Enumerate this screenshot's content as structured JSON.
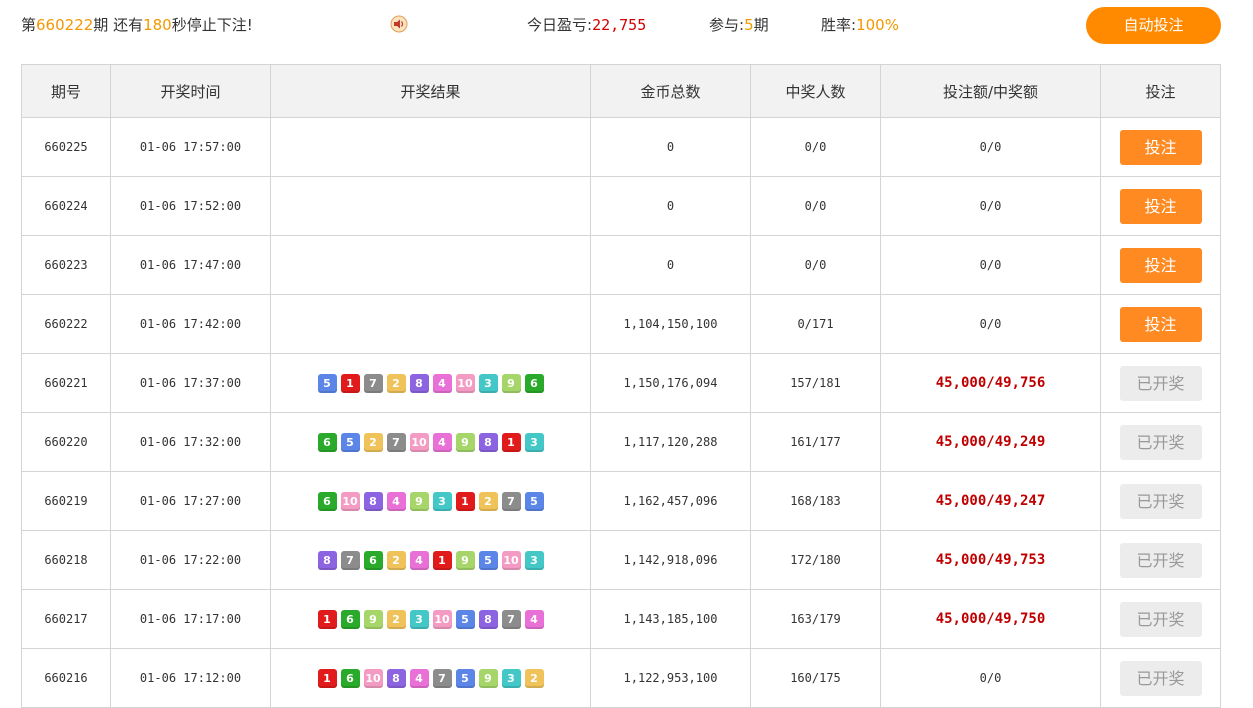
{
  "header": {
    "period_prefix": "第",
    "period_number": "660222",
    "period_suffix": "期",
    "countdown_prefix": "还有",
    "countdown_seconds": "180",
    "countdown_suffix": "秒停止下注!",
    "today_profit_label": "今日盈亏:",
    "today_profit_value": "22,755",
    "participate_label": "参与:",
    "participate_count": "5",
    "participate_suffix": "期",
    "winrate_label": "胜率:",
    "winrate_value": "100%",
    "auto_bet_label": "自动投注",
    "speaker_icon": "speaker-icon"
  },
  "table": {
    "headers": [
      "期号",
      "开奖时间",
      "开奖结果",
      "金币总数",
      "中奖人数",
      "投注额/中奖额",
      "投注"
    ],
    "rows": [
      {
        "period": "660225",
        "time": "01-06 17:57:00",
        "results": [],
        "coins": "0",
        "winners": "0/0",
        "bet": "0/0",
        "action": "投注",
        "drawn": false
      },
      {
        "period": "660224",
        "time": "01-06 17:52:00",
        "results": [],
        "coins": "0",
        "winners": "0/0",
        "bet": "0/0",
        "action": "投注",
        "drawn": false
      },
      {
        "period": "660223",
        "time": "01-06 17:47:00",
        "results": [],
        "coins": "0",
        "winners": "0/0",
        "bet": "0/0",
        "action": "投注",
        "drawn": false
      },
      {
        "period": "660222",
        "time": "01-06 17:42:00",
        "results": [],
        "coins": "1,104,150,100",
        "winners": "0/171",
        "bet": "0/0",
        "action": "投注",
        "drawn": false
      },
      {
        "period": "660221",
        "time": "01-06 17:37:00",
        "results": [
          5,
          1,
          7,
          2,
          8,
          4,
          10,
          3,
          9,
          6
        ],
        "coins": "1,150,176,094",
        "winners": "157/181",
        "bet": "45,000/49,756",
        "action": "已开奖",
        "drawn": true
      },
      {
        "period": "660220",
        "time": "01-06 17:32:00",
        "results": [
          6,
          5,
          2,
          7,
          10,
          4,
          9,
          8,
          1,
          3
        ],
        "coins": "1,117,120,288",
        "winners": "161/177",
        "bet": "45,000/49,249",
        "action": "已开奖",
        "drawn": true
      },
      {
        "period": "660219",
        "time": "01-06 17:27:00",
        "results": [
          6,
          10,
          8,
          4,
          9,
          3,
          1,
          2,
          7,
          5
        ],
        "coins": "1,162,457,096",
        "winners": "168/183",
        "bet": "45,000/49,247",
        "action": "已开奖",
        "drawn": true
      },
      {
        "period": "660218",
        "time": "01-06 17:22:00",
        "results": [
          8,
          7,
          6,
          2,
          4,
          1,
          9,
          5,
          10,
          3
        ],
        "coins": "1,142,918,096",
        "winners": "172/180",
        "bet": "45,000/49,753",
        "action": "已开奖",
        "drawn": true
      },
      {
        "period": "660217",
        "time": "01-06 17:17:00",
        "results": [
          1,
          6,
          9,
          2,
          3,
          10,
          5,
          8,
          7,
          4
        ],
        "coins": "1,143,185,100",
        "winners": "163/179",
        "bet": "45,000/49,750",
        "action": "已开奖",
        "drawn": true
      },
      {
        "period": "660216",
        "time": "01-06 17:12:00",
        "results": [
          1,
          6,
          10,
          8,
          4,
          7,
          5,
          9,
          3,
          2
        ],
        "coins": "1,122,953,100",
        "winners": "160/175",
        "bet": "0/0",
        "action": "已开奖",
        "drawn": true
      }
    ]
  },
  "colors": {
    "accent_orange": "#ff8a00",
    "highlight_orange": "#f39800",
    "win_red": "#c00000"
  }
}
